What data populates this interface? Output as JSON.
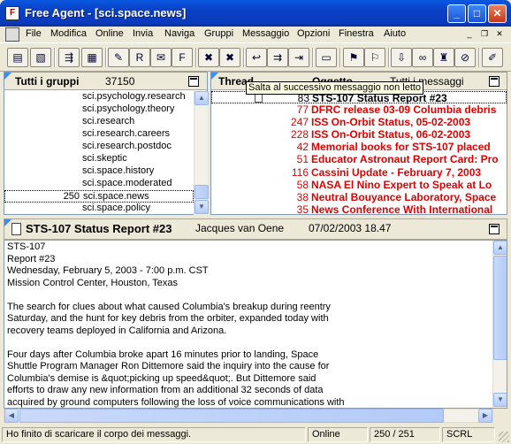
{
  "window": {
    "title": "Free Agent - [sci.space.news]"
  },
  "menubar": {
    "items": [
      "File",
      "Modifica",
      "Online",
      "Invia",
      "Naviga",
      "Gruppi",
      "Messaggio",
      "Opzioni",
      "Finestra",
      "Aiuto"
    ]
  },
  "toolbar": {
    "buttons": [
      "get-messages-icon",
      "read-all-icon",
      "bullets-icon",
      "post-icon",
      "new-article-icon",
      "reply-icon",
      "reply-group-icon",
      "forward-icon",
      "skip-thread-icon",
      "mark-thread-icon",
      "prev-thread-icon",
      "next-unread-icon",
      "next-thread-icon",
      "binary-icon",
      "flag-icon",
      "unflag-icon",
      "download-icon",
      "watch-icon",
      "lock-icon",
      "ignore-icon",
      "clear-icon"
    ]
  },
  "groups": {
    "title": "Tutti i gruppi",
    "count": "37150",
    "rows": [
      {
        "count": "",
        "name": "sci.psychology.research"
      },
      {
        "count": "",
        "name": "sci.psychology.theory"
      },
      {
        "count": "",
        "name": "sci.research"
      },
      {
        "count": "",
        "name": "sci.research.careers"
      },
      {
        "count": "",
        "name": "sci.research.postdoc"
      },
      {
        "count": "",
        "name": "sci.skeptic"
      },
      {
        "count": "",
        "name": "sci.space.history"
      },
      {
        "count": "",
        "name": "sci.space.moderated"
      },
      {
        "count": "250",
        "name": "sci.space.news"
      },
      {
        "count": "",
        "name": "sci.space.policy"
      }
    ]
  },
  "threads": {
    "col_thread": "Thread",
    "col_subject": "Oggetto",
    "col_all": "Tutti i messaggi",
    "tooltip": "Salta al successivo messaggio non letto",
    "rows": [
      {
        "count": "83",
        "subject": "STS-107 Status Report #23"
      },
      {
        "count": "77",
        "subject": "DFRC release 03-09 Columbia debris"
      },
      {
        "count": "247",
        "subject": "ISS On-Orbit Status, 05-02-2003"
      },
      {
        "count": "228",
        "subject": "ISS On-Orbit Status, 06-02-2003"
      },
      {
        "count": "42",
        "subject": "Memorial books for STS-107 placed"
      },
      {
        "count": "51",
        "subject": "Educator Astronaut Report Card: Pro"
      },
      {
        "count": "116",
        "subject": "Cassini Update - February 7, 2003"
      },
      {
        "count": "58",
        "subject": "NASA El Nino Expert to Speak at Lo"
      },
      {
        "count": "38",
        "subject": "Neutral Bouyance Laboratory, Space"
      },
      {
        "count": "35",
        "subject": "News Conference With International"
      }
    ]
  },
  "article": {
    "title": "STS-107 Status Report #23",
    "author": "Jacques van Oene",
    "date": "07/02/2003 18.47",
    "body": "STS-107\nReport #23\nWednesday, February 5, 2003 - 7:00 p.m. CST\nMission Control Center, Houston, Texas\n\nThe search for clues about what caused Columbia's breakup during reentry\nSaturday, and the hunt for key debris from the orbiter, expanded today with\nrecovery teams deployed in California and Arizona.\n\nFour days after Columbia broke apart 16 minutes prior to landing, Space\nShuttle Program Manager Ron Dittemore said the inquiry into the cause for\nColumbia's demise is &quot;picking up speed&quot;. But Dittemore said\nefforts to draw any new information from an additional 32 seconds of data\nacquired by ground computers following the loss of voice communications with"
  },
  "status": {
    "message": "Ho finito di scaricare il corpo dei messaggi.",
    "mode": "Online",
    "counter": "250 / 251",
    "scroll": "SCRL"
  }
}
